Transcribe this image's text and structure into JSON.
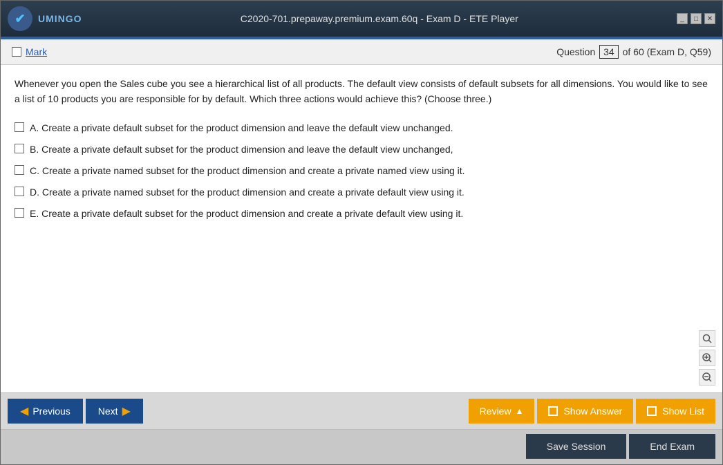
{
  "titleBar": {
    "title": "C2020-701.prepaway.premium.exam.60q - Exam D - ETE Player",
    "logoText": "UMINGO",
    "controls": {
      "minimize": "_",
      "restore": "□",
      "close": "✕"
    }
  },
  "questionHeader": {
    "markLabel": "Mark",
    "questionLabel": "Question",
    "questionNumber": "34",
    "totalText": "of 60 (Exam D, Q59)"
  },
  "question": {
    "text": "Whenever you open the Sales cube you see a hierarchical list of all products. The default view consists of default subsets for all dimensions. You would like to see a list of 10 products you are responsible for by default. Which three actions would achieve this? (Choose three.)",
    "options": [
      {
        "id": "A",
        "text": "A. Create a private default subset for the product dimension and leave the default view unchanged."
      },
      {
        "id": "B",
        "text": "B. Create a private default subset for the product dimension and leave the default view unchanged,"
      },
      {
        "id": "C",
        "text": "C. Create a private named subset for the product dimension and create a private named view using it."
      },
      {
        "id": "D",
        "text": "D. Create a private named subset for the product dimension and create a private default view using it."
      },
      {
        "id": "E",
        "text": "E. Create a private default subset for the product dimension and create a private default view using it."
      }
    ]
  },
  "zoom": {
    "searchIcon": "🔍",
    "zoomInIcon": "⊕",
    "zoomOutIcon": "⊖"
  },
  "navigation": {
    "previousLabel": "Previous",
    "nextLabel": "Next",
    "reviewLabel": "Review",
    "showAnswerLabel": "Show Answer",
    "showListLabel": "Show List",
    "saveSessionLabel": "Save Session",
    "endExamLabel": "End Exam"
  }
}
